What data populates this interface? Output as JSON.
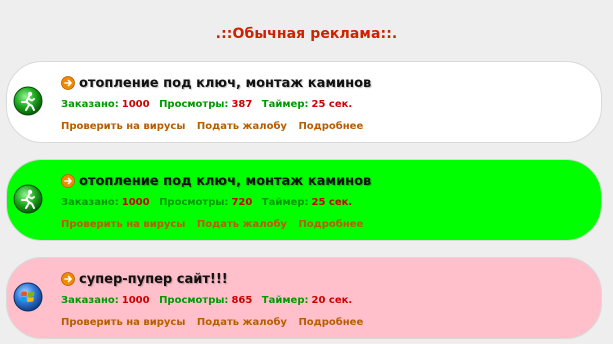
{
  "section": {
    "title": ".::Обычная реклама::."
  },
  "ads": [
    {
      "bg": "#ffffff",
      "icon": "running-man-icon",
      "title": "отопление под ключ, монтаж каминов",
      "label_color": "#009900",
      "ordered_label": "Заказано:",
      "ordered_value": "1000",
      "views_label": "Просмотры:",
      "views_value": "387",
      "timer_label": "Таймер:",
      "timer_value": "25 сек.",
      "link_check": "Проверить на вирусы",
      "link_complain": "Подать жалобу",
      "link_more": "Подробнее"
    },
    {
      "bg": "#00ff00",
      "icon": "running-man-icon",
      "title": "отопление под ключ, монтаж каминов",
      "label_color": "#009900",
      "ordered_label": "Заказано:",
      "ordered_value": "1000",
      "views_label": "Просмотры:",
      "views_value": "720",
      "timer_label": "Таймер:",
      "timer_value": "25 сек.",
      "link_check": "Проверить на вирусы",
      "link_complain": "Подать жалобу",
      "link_more": "Подробнее"
    },
    {
      "bg": "#ffc0cb",
      "icon": "windows-logo-icon",
      "title": "супер-пупер сайт!!!",
      "label_color": "#009900",
      "ordered_label": "Заказано:",
      "ordered_value": "1000",
      "views_label": "Просмотры:",
      "views_value": "865",
      "timer_label": "Таймер:",
      "timer_value": "20 сек.",
      "link_check": "Проверить на вирусы",
      "link_complain": "Подать жалобу",
      "link_more": "Подробнее"
    }
  ],
  "colors": {
    "title_red": "#cc2200",
    "value_red": "#cc0000",
    "link_brown": "#b85c00"
  }
}
